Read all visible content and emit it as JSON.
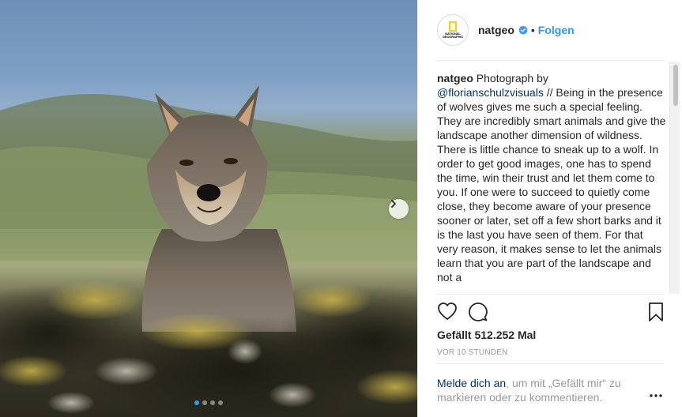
{
  "post": {
    "image_alt": "",
    "carousel": {
      "count": 4,
      "active_index": 0
    }
  },
  "header": {
    "username": "natgeo",
    "separator": "•",
    "follow_label": "Folgen",
    "avatar_text": "NATIONAL GEOGRAPHIC"
  },
  "caption": {
    "username": "natgeo",
    "text_before_mention": " Photograph by",
    "mention": "@florianschulzvisuals",
    "text_after_mention": " // Being in the presence of wolves gives me such a special feeling. They are incredibly smart animals and give the landscape another dimension of wildness. There is little chance to sneak up to a wolf. In order to get good images, one has to spend the time, win their trust and let them come to you. If one were to succeed to quietly come close, they become aware of your presence sooner or later, set off a few short barks and it is the last you have seen of them. For that very reason, it makes sense to let the animals learn that you are part of the landscape and not a"
  },
  "stats": {
    "likes": "Gefällt 512.252 Mal",
    "timestamp": "VOR 10 STUNDEN"
  },
  "login": {
    "link_label": "Melde dich an",
    "rest": ", um mit „Gefällt mir“ zu markieren oder zu kommentieren."
  },
  "icons": {
    "heart": "heart-icon",
    "comment": "comment-icon",
    "bookmark": "bookmark-icon",
    "more": "more-options-icon",
    "next": "chevron-right-icon",
    "verified": "verified-badge-icon"
  },
  "colors": {
    "link_blue": "#3897f0",
    "mention_blue": "#003569",
    "muted": "#999999",
    "text": "#262626"
  }
}
